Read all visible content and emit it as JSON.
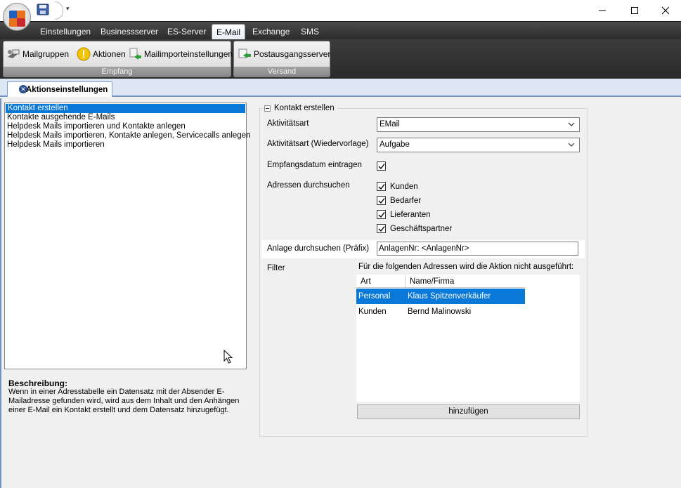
{
  "window": {
    "minimize_glyph": "—",
    "maximize_glyph": "☐",
    "close_glyph": "✕",
    "quick_access_dropdown": "▾"
  },
  "menu": {
    "tabs": [
      {
        "label": "Einstellungen"
      },
      {
        "label": "Businessserver"
      },
      {
        "label": "ES-Server"
      },
      {
        "label": "E-Mail",
        "active": true
      },
      {
        "label": "Exchange"
      },
      {
        "label": "SMS"
      }
    ]
  },
  "ribbon": {
    "groups": [
      {
        "label": "Empfang",
        "buttons": [
          {
            "label": "Mailgruppen",
            "icon": "mail-groups-icon"
          },
          {
            "label": "Aktionen",
            "icon": "warning-icon"
          },
          {
            "label": "Mailimporteinstellungen",
            "icon": "mail-import-icon"
          }
        ]
      },
      {
        "label": "Versand",
        "buttons": [
          {
            "label": "Postausgangsserver",
            "icon": "outgoing-server-icon"
          }
        ]
      }
    ]
  },
  "doc_tab": {
    "label": "Aktionseinstellungen",
    "icon": "close-icon"
  },
  "action_list": {
    "items": [
      "Kontakt erstellen",
      "Kontakte ausgehende E-Mails",
      "Helpdesk Mails importieren und Kontakte anlegen",
      "Helpdesk Mails importieren, Kontakte anlegen, Servicecalls anlegen",
      "Helpdesk Mails importieren"
    ],
    "selected_index": 0
  },
  "description": {
    "title": "Beschreibung:",
    "text": "Wenn in einer Adresstabelle ein Datensatz mit der Absender E-Mailadresse gefunden wird, wird aus dem Inhalt und den Anhängen einer E-Mail ein Kontakt erstellt und dem Datensatz hinzugefügt."
  },
  "form": {
    "group_title": "Kontakt erstellen",
    "activity_type": {
      "label": "Aktivitätsart",
      "value": "EMail"
    },
    "followup_type": {
      "label": "Aktivitätsart (Wiedervorlage)",
      "value": "Aufgabe"
    },
    "receive_date": {
      "label": "Empfangsdatum eintragen",
      "checked": true
    },
    "search_addresses": {
      "label": "Adressen durchsuchen",
      "options": [
        {
          "label": "Kunden",
          "checked": true
        },
        {
          "label": "Bedarfer",
          "checked": true
        },
        {
          "label": "Lieferanten",
          "checked": true
        },
        {
          "label": "Geschäftspartner",
          "checked": true
        }
      ]
    },
    "attachment_prefix": {
      "label": "Anlage durchsuchen (Präfix)",
      "value": "AnlagenNr: <AnlagenNr>"
    },
    "filter": {
      "label": "Filter",
      "hint": "Für die folgenden Adressen wird die Aktion nicht ausgeführt:",
      "columns": [
        "Art",
        "Name/Firma"
      ],
      "rows": [
        {
          "art": "Personal",
          "name": "Klaus Spitzenverkäufer",
          "selected": true
        },
        {
          "art": "Kunden",
          "name": "Bernd Malinowski",
          "selected": false
        }
      ],
      "add_label": "hinzufügen"
    }
  },
  "colors": {
    "selection": "#0a78d7",
    "menu_bar": "#2c2c2c",
    "accent_blue": "#6f93c3"
  }
}
